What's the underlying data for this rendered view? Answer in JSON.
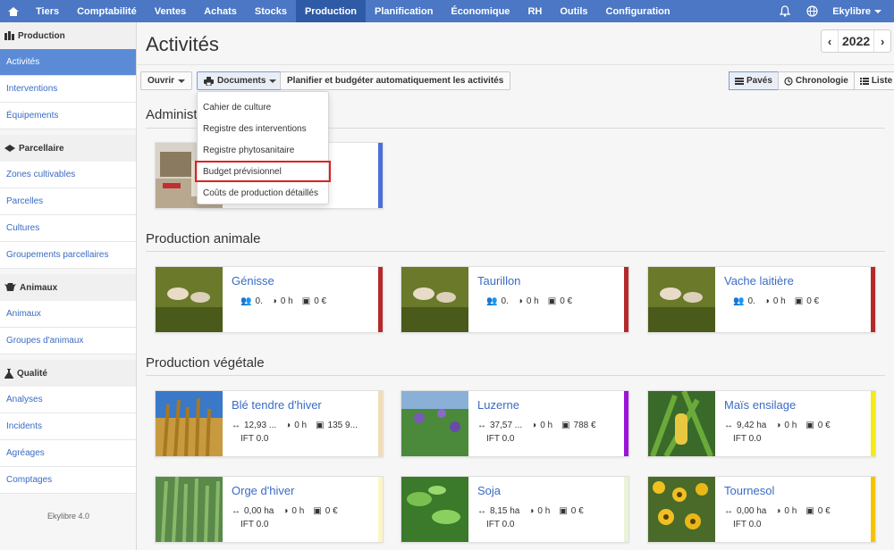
{
  "topnav": {
    "items": [
      "Tiers",
      "Comptabilité",
      "Ventes",
      "Achats",
      "Stocks",
      "Production",
      "Planification",
      "Économique",
      "RH",
      "Outils",
      "Configuration"
    ],
    "active": "Production",
    "user": "Ekylibre"
  },
  "sidebar": {
    "sections": [
      {
        "title": "Production",
        "icon": "production-icon",
        "items": [
          "Activités",
          "Interventions",
          "Équipements"
        ]
      },
      {
        "title": "Parcellaire",
        "icon": "land-parcel-icon",
        "items": [
          "Zones cultivables",
          "Parcelles",
          "Cultures",
          "Groupements parcellaires"
        ]
      },
      {
        "title": "Animaux",
        "icon": "animal-icon",
        "items": [
          "Animaux",
          "Groupes d'animaux"
        ]
      },
      {
        "title": "Qualité",
        "icon": "flask-icon",
        "items": [
          "Analyses",
          "Incidents",
          "Agréages",
          "Comptages"
        ]
      }
    ],
    "active_item": "Activités",
    "footer": "Ekylibre 4.0"
  },
  "page": {
    "title": "Activités",
    "year": "2022"
  },
  "toolbar": {
    "open_label": "Ouvrir",
    "documents_label": "Documents",
    "plan_label": "Planifier et budgéter automatiquement les activités",
    "views": [
      {
        "label": "Pavés",
        "active": true
      },
      {
        "label": "Chronologie",
        "active": false
      },
      {
        "label": "Liste",
        "active": false
      }
    ]
  },
  "documents_menu": {
    "items": [
      "Cahier de culture",
      "Registre des interventions",
      "Registre phytosanitaire",
      "Budget prévisionnel",
      "Coûts de production détaillés"
    ],
    "highlighted": "Budget prévisionnel"
  },
  "sections": [
    {
      "title": "Administ",
      "cards": [
        {
          "title": "",
          "area": "",
          "time": "",
          "cost": "",
          "ift": "",
          "color": "#4b6fd6"
        }
      ]
    },
    {
      "title": "Production animale",
      "cards": [
        {
          "title": "Génisse",
          "area": "0.",
          "time": "0 h",
          "cost": "0 €",
          "ift": "",
          "color": "#b42a2a"
        },
        {
          "title": "Taurillon",
          "area": "0.",
          "time": "0 h",
          "cost": "0 €",
          "ift": "",
          "color": "#b42a2a"
        },
        {
          "title": "Vache laitière",
          "area": "0.",
          "time": "0 h",
          "cost": "0 €",
          "ift": "",
          "color": "#b42a2a"
        }
      ]
    },
    {
      "title": "Production végétale",
      "cards": [
        {
          "title": "Blé tendre d'hiver",
          "area": "12,93 ...",
          "time": "0 h",
          "cost": "135 9...",
          "ift": "IFT 0.0",
          "color": "#f3ddb5"
        },
        {
          "title": "Luzerne",
          "area": "37,57 ...",
          "time": "0 h",
          "cost": "788 €",
          "ift": "IFT 0.0",
          "color": "#9b12d8"
        },
        {
          "title": "Maïs ensilage",
          "area": "9,42 ha",
          "time": "0 h",
          "cost": "0 €",
          "ift": "IFT 0.0",
          "color": "#f2ea1a"
        },
        {
          "title": "Orge d'hiver",
          "area": "0,00 ha",
          "time": "0 h",
          "cost": "0 €",
          "ift": "IFT 0.0",
          "color": "#fbf6c4"
        },
        {
          "title": "Soja",
          "area": "8,15 ha",
          "time": "0 h",
          "cost": "0 €",
          "ift": "IFT 0.0",
          "color": "#e8f4d8"
        },
        {
          "title": "Tournesol",
          "area": "0,00 ha",
          "time": "0 h",
          "cost": "0 €",
          "ift": "IFT 0.0",
          "color": "#f5c400"
        }
      ]
    }
  ]
}
